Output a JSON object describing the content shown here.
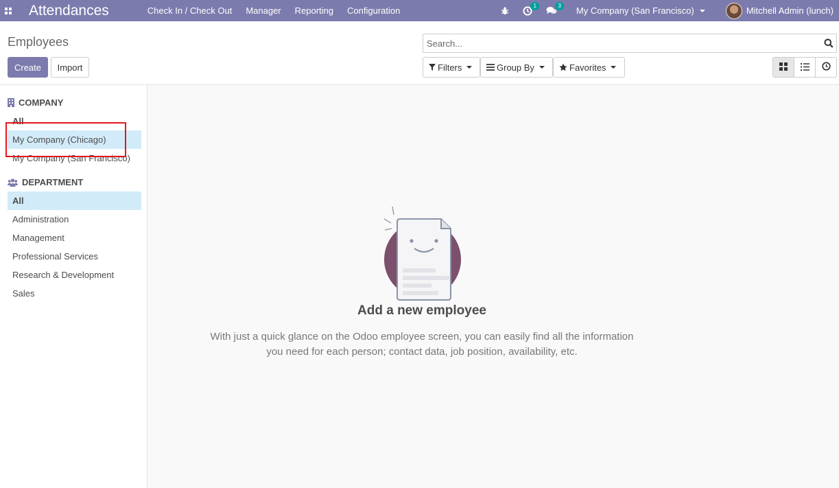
{
  "navbar": {
    "app_title": "Attendances",
    "menu": [
      "Check In / Check Out",
      "Manager",
      "Reporting",
      "Configuration"
    ],
    "activity_badge": "1",
    "messages_badge": "3",
    "company": "My Company (San Francisco)",
    "user": "Mitchell Admin (lunch)",
    "colors": {
      "bar": "#7c7bad",
      "badge": "#00a09d"
    }
  },
  "control_panel": {
    "title": "Employees",
    "create_label": "Create",
    "import_label": "Import",
    "search_placeholder": "Search...",
    "filters_label": "Filters",
    "groupby_label": "Group By",
    "favorites_label": "Favorites",
    "views": [
      "kanban-icon",
      "list-icon",
      "activity-icon"
    ]
  },
  "side_panel": {
    "company_header": "COMPANY",
    "company_items": [
      "All",
      "My Company (Chicago)",
      "My Company (San Francisco)"
    ],
    "department_header": "DEPARTMENT",
    "department_items": [
      "All",
      "Administration",
      "Management",
      "Professional Services",
      "Research & Development",
      "Sales"
    ]
  },
  "empty_state": {
    "title": "Add a new employee",
    "text": "With just a quick glance on the Odoo employee screen, you can easily find all the information you need for each person; contact data, job position, availability, etc."
  }
}
